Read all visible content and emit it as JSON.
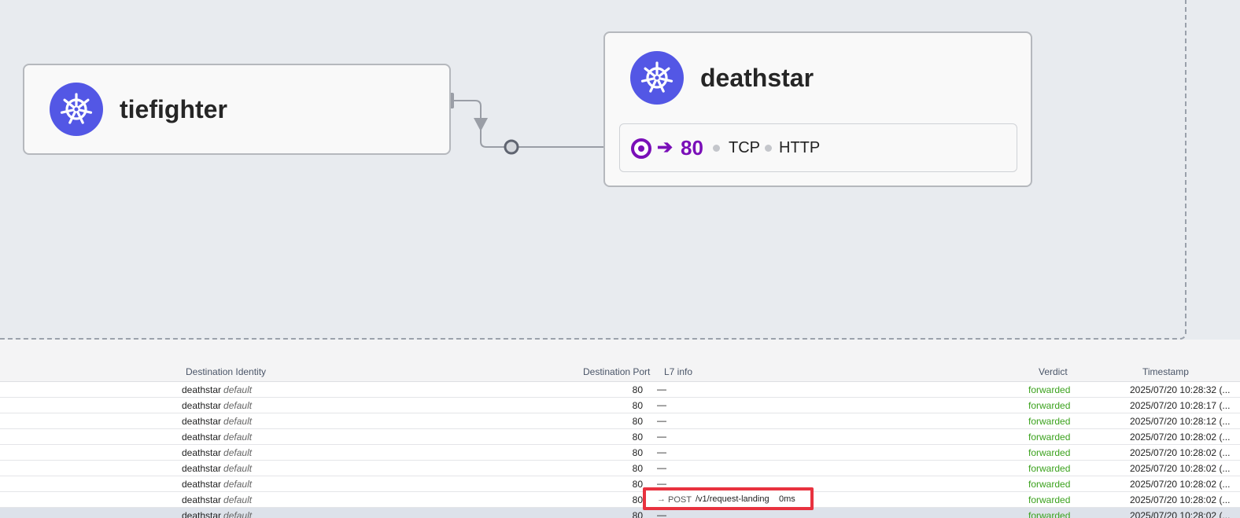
{
  "map": {
    "nodes": [
      {
        "id": "tiefighter",
        "label": "tiefighter",
        "icon": "kubernetes-icon"
      },
      {
        "id": "deathstar",
        "label": "deathstar",
        "icon": "kubernetes-icon"
      }
    ],
    "endpoint": {
      "arrow": "➔",
      "port": "80",
      "protocols": [
        "TCP",
        "HTTP"
      ]
    },
    "colors": {
      "k8s_logo": "#5357e5",
      "endpoint_accent": "#7a0fb8",
      "namespace_border": "#9aa1ab"
    }
  },
  "table": {
    "headers": {
      "destination_identity": "Destination Identity",
      "destination_port": "Destination Port",
      "l7_info": "L7 info",
      "verdict": "Verdict",
      "timestamp": "Timestamp"
    },
    "rows": [
      {
        "dest": "deathstar",
        "ns": "default",
        "port": "80",
        "l7": "—",
        "verdict": "forwarded",
        "ts": "2025/07/20 10:28:32 (..."
      },
      {
        "dest": "deathstar",
        "ns": "default",
        "port": "80",
        "l7": "—",
        "verdict": "forwarded",
        "ts": "2025/07/20 10:28:17 (..."
      },
      {
        "dest": "deathstar",
        "ns": "default",
        "port": "80",
        "l7": "—",
        "verdict": "forwarded",
        "ts": "2025/07/20 10:28:12 (..."
      },
      {
        "dest": "deathstar",
        "ns": "default",
        "port": "80",
        "l7": "—",
        "verdict": "forwarded",
        "ts": "2025/07/20 10:28:02 (..."
      },
      {
        "dest": "deathstar",
        "ns": "default",
        "port": "80",
        "l7": "—",
        "verdict": "forwarded",
        "ts": "2025/07/20 10:28:02 (..."
      },
      {
        "dest": "deathstar",
        "ns": "default",
        "port": "80",
        "l7": "—",
        "verdict": "forwarded",
        "ts": "2025/07/20 10:28:02 (..."
      },
      {
        "dest": "deathstar",
        "ns": "default",
        "port": "80",
        "l7": "—",
        "verdict": "forwarded",
        "ts": "2025/07/20 10:28:02 (..."
      },
      {
        "dest": "deathstar",
        "ns": "default",
        "port": "80",
        "l7": "",
        "verdict": "forwarded",
        "ts": "2025/07/20 10:28:02 (..."
      },
      {
        "dest": "deathstar",
        "ns": "default",
        "port": "80",
        "l7": "—",
        "verdict": "forwarded",
        "ts": "2025/07/20 10:28:02 (..."
      }
    ],
    "highlighted_l7": {
      "arrow": "→",
      "method": "POST",
      "path": "/v1/request-landing",
      "latency": "0ms"
    },
    "colors": {
      "verdict_forwarded": "#3ba21d",
      "highlight_border": "#e8323f",
      "selected_row": "#dde2ea"
    }
  }
}
